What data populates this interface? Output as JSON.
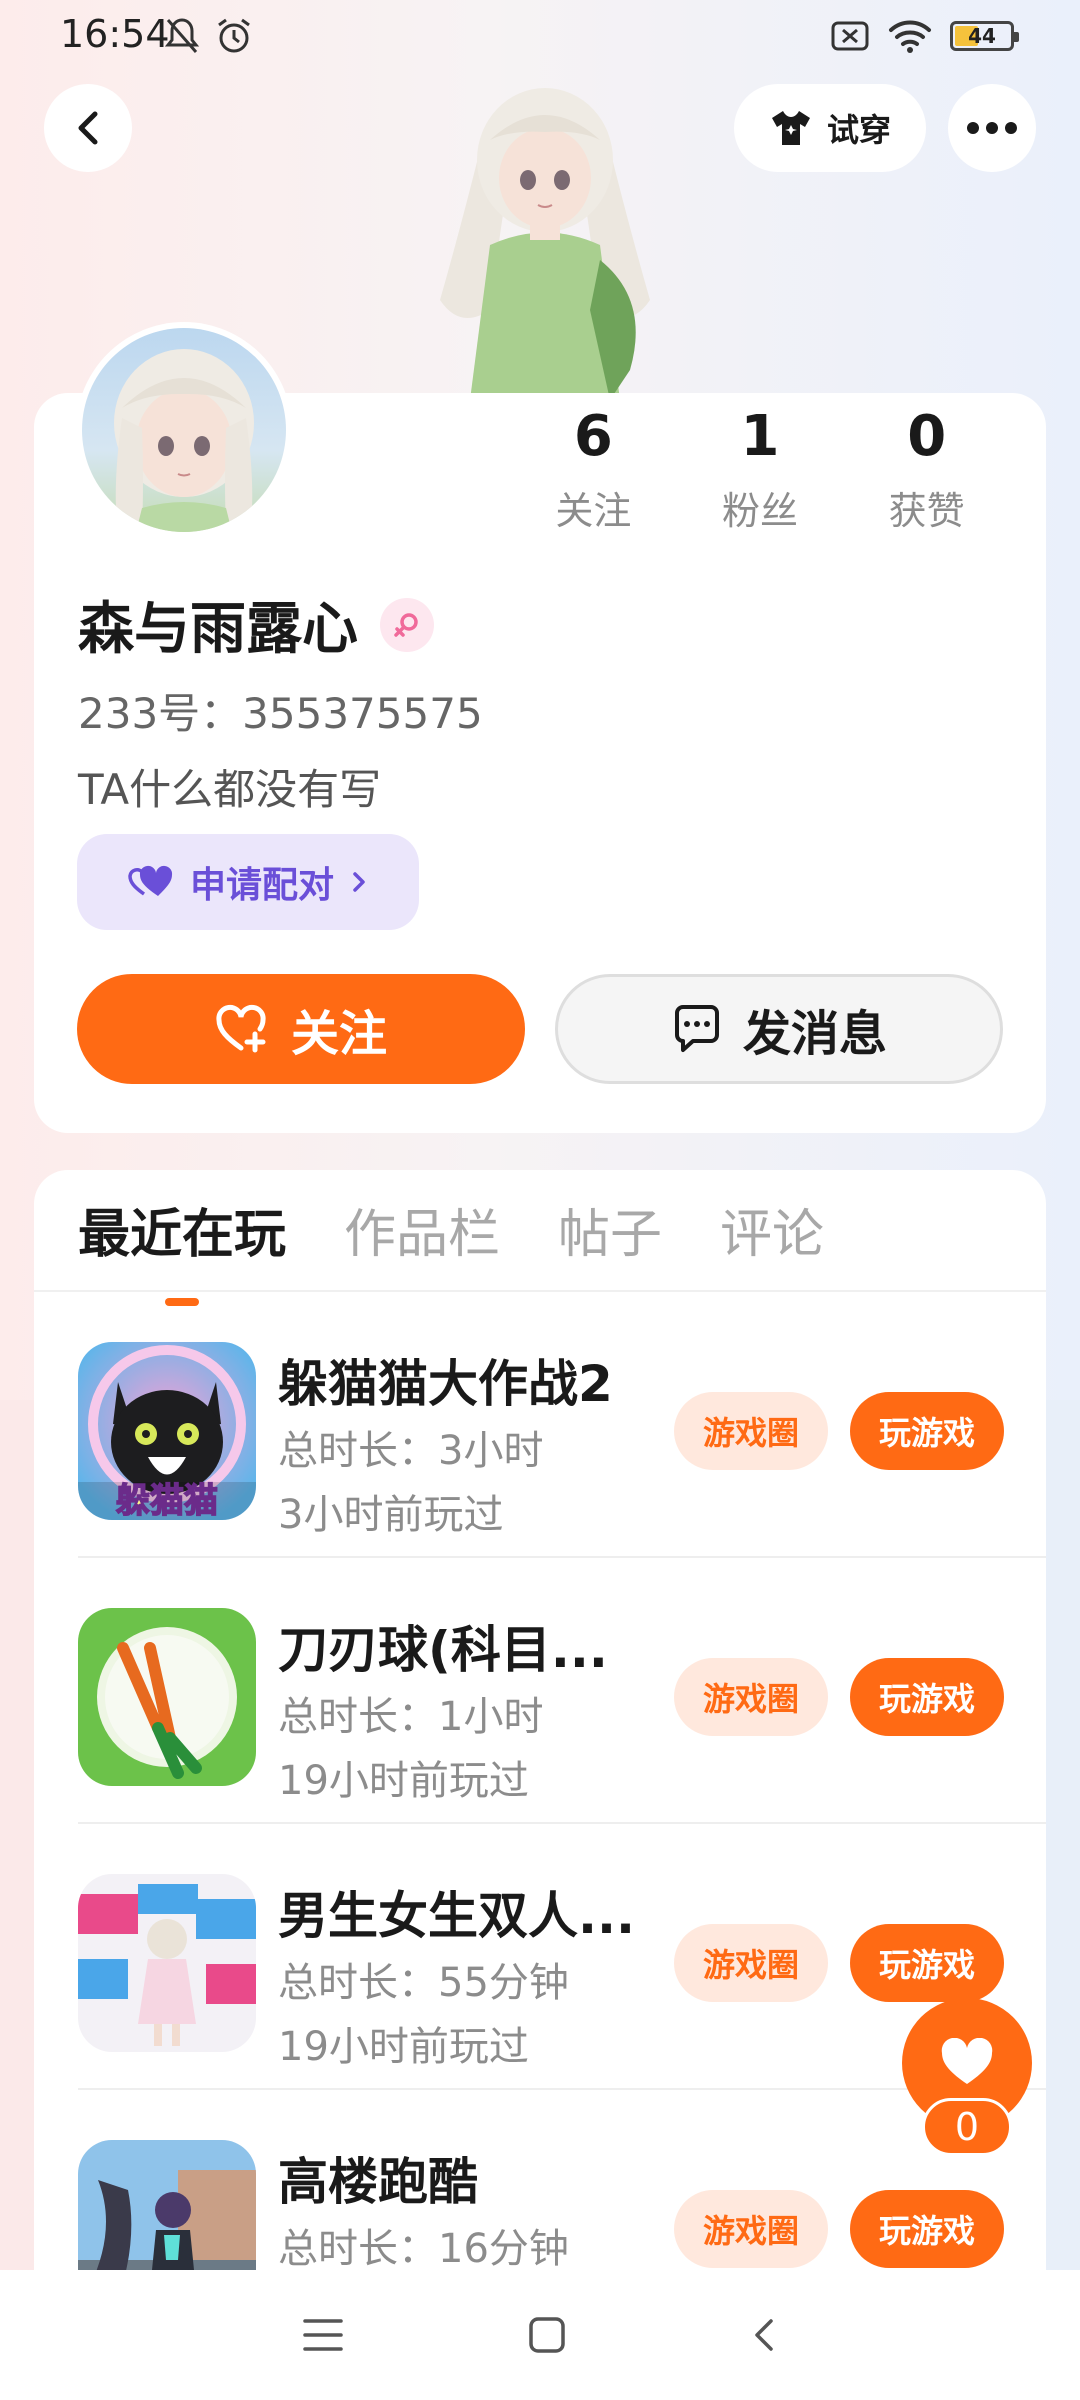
{
  "status_bar": {
    "time": "16:54",
    "battery": "44"
  },
  "header": {
    "tryon_label": "试穿"
  },
  "profile": {
    "stats": [
      {
        "value": "6",
        "label": "关注"
      },
      {
        "value": "1",
        "label": "粉丝"
      },
      {
        "value": "0",
        "label": "获赞"
      }
    ],
    "name": "森与雨露心",
    "uid": "233号：355375575",
    "bio": "TA什么都没有写",
    "pair_label": "申请配对",
    "follow_label": "关注",
    "message_label": "发消息"
  },
  "tabs": [
    "最近在玩",
    "作品栏",
    "帖子",
    "评论"
  ],
  "games": [
    {
      "title": "躲猫猫大作战2",
      "duration": "总时长：3小时",
      "last_played": "3小时前玩过",
      "icon_text": "躲猫猫"
    },
    {
      "title": "刀刃球(科目...",
      "duration": "总时长：1小时",
      "last_played": "19小时前玩过"
    },
    {
      "title": "男生女生双人...",
      "duration": "总时长：55分钟",
      "last_played": "19小时前玩过"
    },
    {
      "title": "高楼跑酷",
      "duration": "总时长：16分钟",
      "last_played": ""
    }
  ],
  "game_buttons": {
    "circle": "游戏圈",
    "play": "玩游戏"
  },
  "fab": {
    "like_count": "0"
  },
  "colors": {
    "accent": "#ff6a14",
    "pair_purple": "#6a4fd8",
    "pair_bg": "#ebe6fb"
  }
}
